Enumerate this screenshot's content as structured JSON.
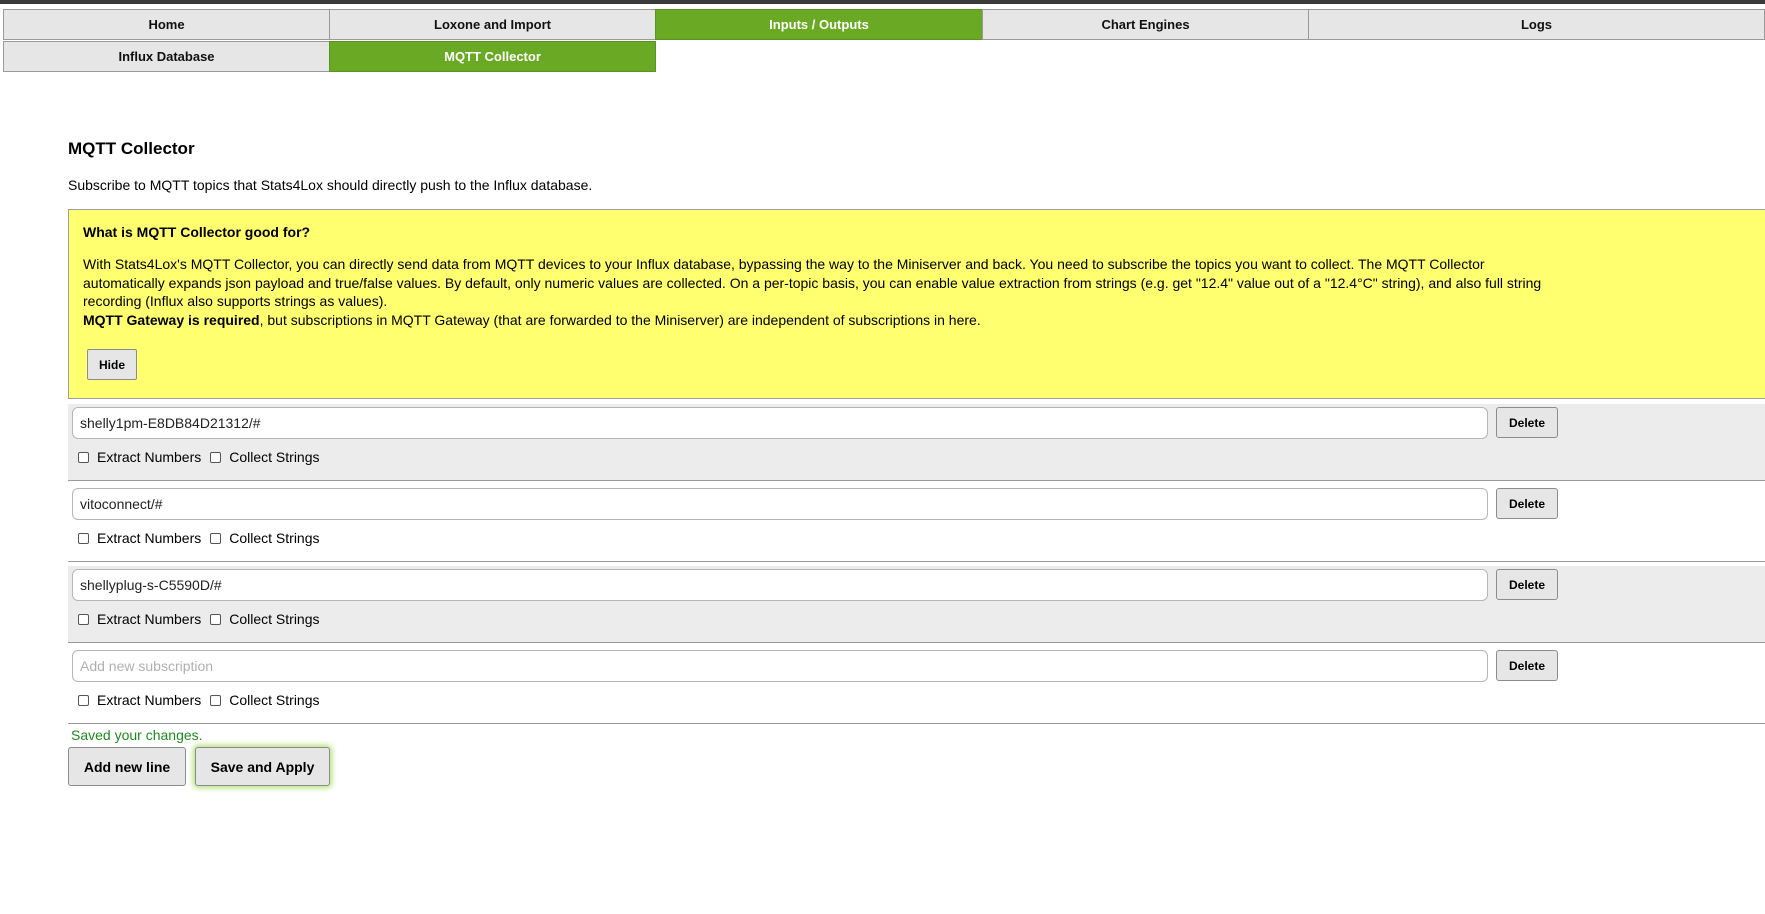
{
  "nav": {
    "row1": [
      "Home",
      "Loxone and Import",
      "Inputs / Outputs",
      "Chart Engines",
      "Logs"
    ],
    "row2": [
      "Influx Database",
      "MQTT Collector"
    ],
    "active_row1": "Inputs / Outputs",
    "active_row2": "MQTT Collector"
  },
  "page": {
    "title": "MQTT Collector",
    "subtitle": "Subscribe to MQTT topics that Stats4Lox should directly push to the Influx database."
  },
  "info": {
    "heading": "What is MQTT Collector good for?",
    "paragraph": "With Stats4Lox's MQTT Collector, you can directly send data from MQTT devices to your Influx database, bypassing the way to the Miniserver and back. You need to subscribe the topics you want to collect. The MQTT Collector automatically expands json payload and true/false values. By default, only numeric values are collected. On a per-topic basis, you can enable value extraction from strings (e.g. get \"12.4\" value out of a \"12.4°C\" string), and also full string recording (Influx also supports strings as values).",
    "bold_note": "MQTT Gateway is required",
    "note_rest": ", but subscriptions in MQTT Gateway (that are forwarded to the Miniserver) are independent of subscriptions in here.",
    "hide_label": "Hide"
  },
  "subscriptions": [
    {
      "value": "shelly1pm-E8DB84D21312/#",
      "placeholder": "Add new subscription",
      "extract_numbers": false,
      "collect_strings": false
    },
    {
      "value": "vitoconnect/#",
      "placeholder": "Add new subscription",
      "extract_numbers": false,
      "collect_strings": false
    },
    {
      "value": "shellyplug-s-C5590D/#",
      "placeholder": "Add new subscription",
      "extract_numbers": false,
      "collect_strings": false
    },
    {
      "value": "",
      "placeholder": "Add new subscription",
      "extract_numbers": false,
      "collect_strings": false
    }
  ],
  "labels": {
    "delete": "Delete",
    "extract_numbers": "Extract Numbers",
    "collect_strings": "Collect Strings"
  },
  "status": "Saved your changes.",
  "actions": {
    "add_line": "Add new line",
    "save_apply": "Save and Apply"
  },
  "colors": {
    "active_tab": "#6aa923",
    "info_background": "#ffff70",
    "status_text": "#1f8a1f"
  }
}
